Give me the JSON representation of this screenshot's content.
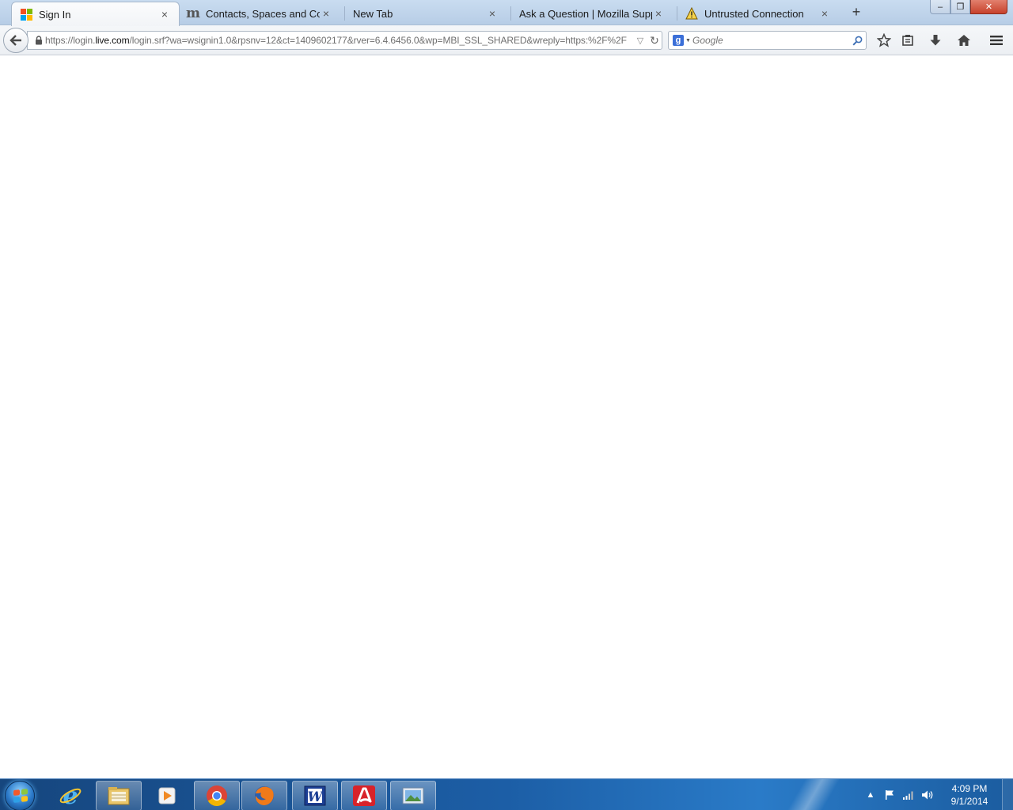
{
  "browser": {
    "tabs": [
      {
        "label": "Sign In",
        "icon": "microsoft-logo-icon",
        "active": true
      },
      {
        "label": "Contacts, Spaces and Com...",
        "icon": "m-logo-icon",
        "active": false
      },
      {
        "label": "New Tab",
        "icon": "",
        "active": false
      },
      {
        "label": "Ask a Question | Mozilla Support",
        "icon": "",
        "active": false
      },
      {
        "label": "Untrusted Connection",
        "icon": "warning-icon",
        "active": false
      }
    ],
    "close_glyph": "×",
    "new_tab_glyph": "+",
    "window_controls": {
      "minimize": "–",
      "restore": "❐",
      "close": "✕"
    },
    "url": {
      "prefix": "https://login.",
      "domain": "live.com",
      "suffix": "/login.srf?wa=wsignin1.0&rpsnv=12&ct=1409602177&rver=6.4.6456.0&wp=MBI_SSL_SHARED&wreply=https:%2F%2F"
    },
    "search": {
      "placeholder": "Google",
      "engine": "google-icon"
    }
  },
  "taskbar": {
    "apps": [
      {
        "name": "internet-explorer-icon"
      },
      {
        "name": "windows-explorer-icon"
      },
      {
        "name": "media-player-icon"
      },
      {
        "name": "chrome-icon"
      },
      {
        "name": "firefox-icon"
      },
      {
        "name": "word-icon"
      },
      {
        "name": "avira-icon"
      },
      {
        "name": "photo-viewer-icon"
      }
    ],
    "clock": {
      "time": "4:09 PM",
      "date": "9/1/2014"
    }
  },
  "colors": {
    "taskbar": "#1c5ea6",
    "tab_strip": "#c9dcf0",
    "ms_red": "#f25022",
    "ms_green": "#7fba00",
    "ms_blue": "#00a4ef",
    "ms_yellow": "#ffb900"
  }
}
